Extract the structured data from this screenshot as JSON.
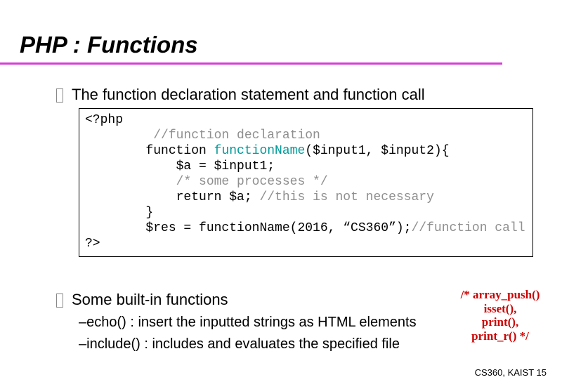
{
  "title": "PHP : Functions",
  "bullets": {
    "b1": "The function declaration statement and function call",
    "b2": "Some built-in functions"
  },
  "code": {
    "l1a": "<?php",
    "l2a": "         ",
    "l2b": "//function declaration",
    "l3a": "        function ",
    "l3b": "functionName",
    "l3c": "($input1, $input2){",
    "l4a": "            $a = $input1;",
    "l5a": "            ",
    "l5b": "/* some processes */",
    "l6a": "            return $a; ",
    "l6b": "//this is not necessary",
    "l7a": "        }",
    "l8a": "        $res = functionName(2016, “CS360”);",
    "l8b": "//function call",
    "l9a": "?>"
  },
  "subitems": {
    "s1": "–echo() : insert the inputted strings as HTML elements",
    "s2": "–include() : includes and evaluates the specified file"
  },
  "side_note": {
    "l1": "/* array_push()",
    "l2": "isset(),",
    "l3": "print(),",
    "l4": "print_r() */"
  },
  "footer": {
    "course": "CS360, KAIST",
    "page": "15"
  }
}
